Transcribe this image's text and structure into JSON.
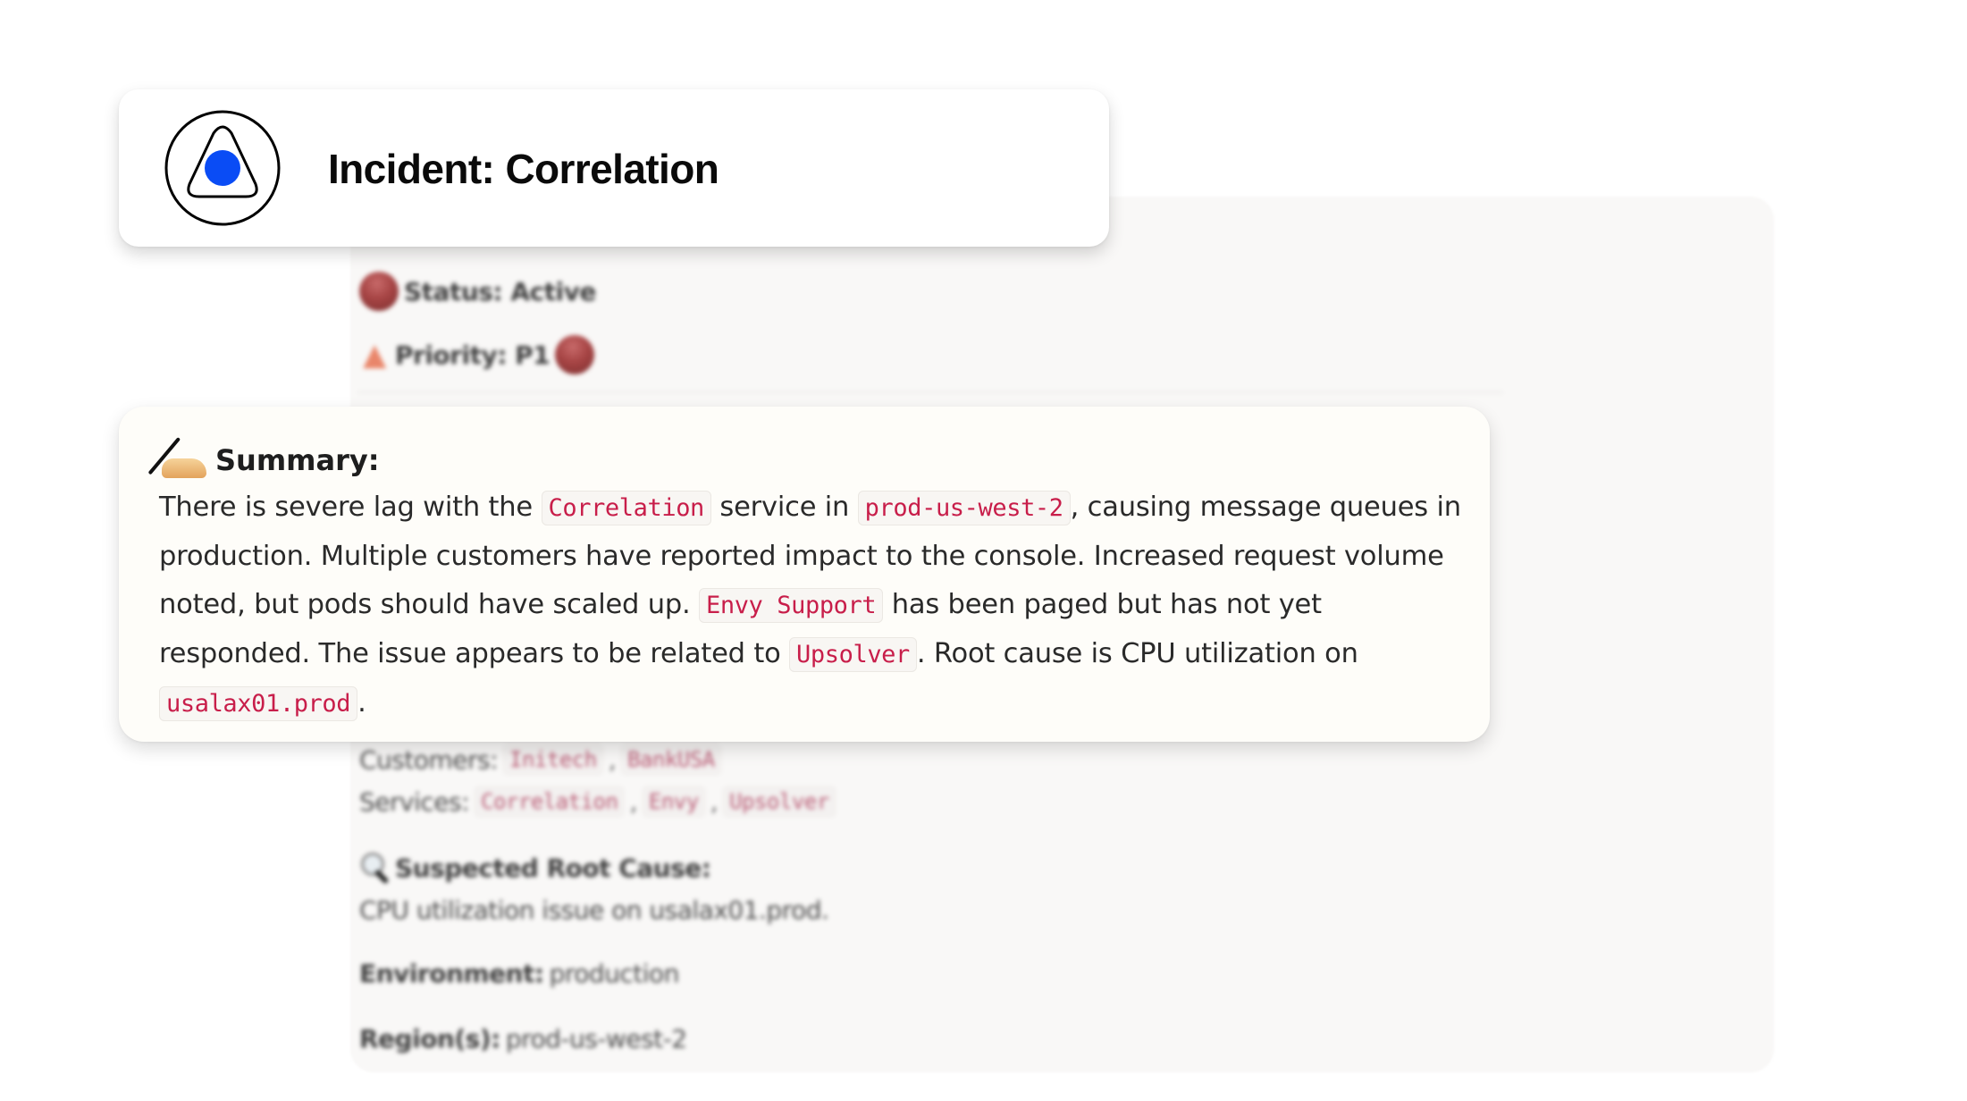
{
  "header": {
    "title": "Incident: Correlation",
    "logo_icon": "incident-logo-icon",
    "brand_color": "#0A4CF5"
  },
  "details": {
    "status_label": "Status: Active",
    "status_icon": "red-circle-icon",
    "priority_label": "Priority: P1",
    "priority_icon": "fire-icon",
    "priority_badge_icon": "red-circle-icon",
    "customers_label": "Customers:",
    "customers": [
      "Initech",
      "BankUSA"
    ],
    "services_label": "Services:",
    "services": [
      "Correlation",
      "Envy",
      "Upsolver"
    ],
    "root_cause_title": "Suspected Root Cause:",
    "root_cause_icon": "magnifier-icon",
    "root_cause_text": "CPU utilization issue on usalax01.prod.",
    "environment_label": "Environment:",
    "environment_value": "production",
    "regions_label": "Region(s):",
    "regions_value": "prod-us-west-2"
  },
  "summary": {
    "icon": "writing-hand-icon",
    "title": "Summary:",
    "segments": [
      {
        "text": "There is severe lag with the ",
        "code": false
      },
      {
        "text": "Correlation",
        "code": true
      },
      {
        "text": " service in ",
        "code": false
      },
      {
        "text": "prod-us-west-2",
        "code": true
      },
      {
        "text": ", causing message queues in production. Multiple customers have reported impact to the console. Increased request volume noted, but pods should have scaled up. ",
        "code": false
      },
      {
        "text": "Envy Support",
        "code": true
      },
      {
        "text": " has been paged but has not yet responded. The issue appears to be related to ",
        "code": false
      },
      {
        "text": "Upsolver",
        "code": true
      },
      {
        "text": ". Root cause is CPU utilization on ",
        "code": false
      },
      {
        "text": "usalax01.prod",
        "code": true
      },
      {
        "text": ".",
        "code": false
      }
    ],
    "code_color": "#C81E4A"
  }
}
